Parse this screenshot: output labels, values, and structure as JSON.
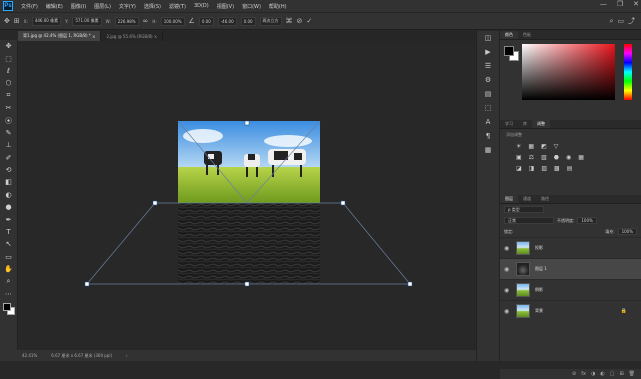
{
  "menubar": {
    "logo": "Ps",
    "items": [
      "文件(F)",
      "编辑(E)",
      "图像(I)",
      "图层(L)",
      "文字(Y)",
      "选择(S)",
      "滤镜(T)",
      "3D(D)",
      "视图(V)",
      "窗口(W)",
      "帮助(H)"
    ],
    "minimize": "—",
    "maximize": "❐",
    "close": "✕"
  },
  "options": {
    "x_label": "X:",
    "x": "446.00 像素",
    "y_label": "Y:",
    "y": "571.00 像素",
    "w_label": "W:",
    "w": "226.98%",
    "h_label": "H:",
    "h": "100.00%",
    "angle": "0.00",
    "h_skew": "-46.00",
    "v_skew": "0.00",
    "interp": "两次立方",
    "cancel": "⊘",
    "commit": "✓",
    "search": "⌕",
    "workspace": "▭",
    "share": "⤴"
  },
  "tabs": [
    {
      "label": "背1.jpg @ 42.4% (图层 1, RGB/8) *",
      "close": "×"
    },
    {
      "label": "2.jpg @ 55.6% (RGB/8)",
      "close": "×"
    }
  ],
  "tools": [
    "✥",
    "⬚",
    "ℓ",
    "⬡",
    "⌗",
    "✂",
    "⦿",
    "✎",
    "⊥",
    "✐",
    "⟲",
    "◧",
    "◐",
    "●",
    "✒",
    "T",
    "↖",
    "▭",
    "✋",
    "⌕",
    "⋯"
  ],
  "canvas": {
    "left_text": "",
    "right_text": ""
  },
  "status": {
    "zoom": "42.41%",
    "doc": "6.67 厘米 x 6.67 厘米 (300 ppi)",
    "arrow": "›"
  },
  "strip_icons": [
    "◫",
    "▶",
    "☰",
    "⚙",
    "▤",
    "⬚",
    "A",
    "¶",
    "▦"
  ],
  "color_panel": {
    "tabs": [
      "颜色",
      "色板"
    ]
  },
  "adjust_panel": {
    "tabs": [
      "学习",
      "库",
      "调整"
    ],
    "label": "添加调整",
    "rows": [
      [
        "☀",
        "▦",
        "◩",
        "▽"
      ],
      [
        "▣",
        "⚖",
        "▧",
        "⬣",
        "◉",
        "▦"
      ],
      [
        "◪",
        "◨",
        "▨",
        "▩",
        "▤"
      ]
    ]
  },
  "layers_panel": {
    "tabs": [
      "图层",
      "通道",
      "路径"
    ],
    "filter": "ρ 类型",
    "blend": "正常",
    "opacity_label": "不透明度:",
    "opacity": "100%",
    "lock_label": "锁定:",
    "fill_label": "填充:",
    "fill": "100%",
    "layers": [
      {
        "name": "投影",
        "eye": "◉",
        "thumb": "photo",
        "selected": false
      },
      {
        "name": "图层 1",
        "eye": "◉",
        "thumb": "dark",
        "selected": true
      },
      {
        "name": "倒影",
        "eye": "◉",
        "thumb": "photo",
        "selected": false
      },
      {
        "name": "背景",
        "eye": "◉",
        "thumb": "photo",
        "selected": false,
        "locked": "🔒"
      }
    ],
    "bottom_icons": [
      "⊘",
      "fx",
      "◑",
      "◐",
      "▢",
      "⊞",
      "🗑"
    ]
  }
}
